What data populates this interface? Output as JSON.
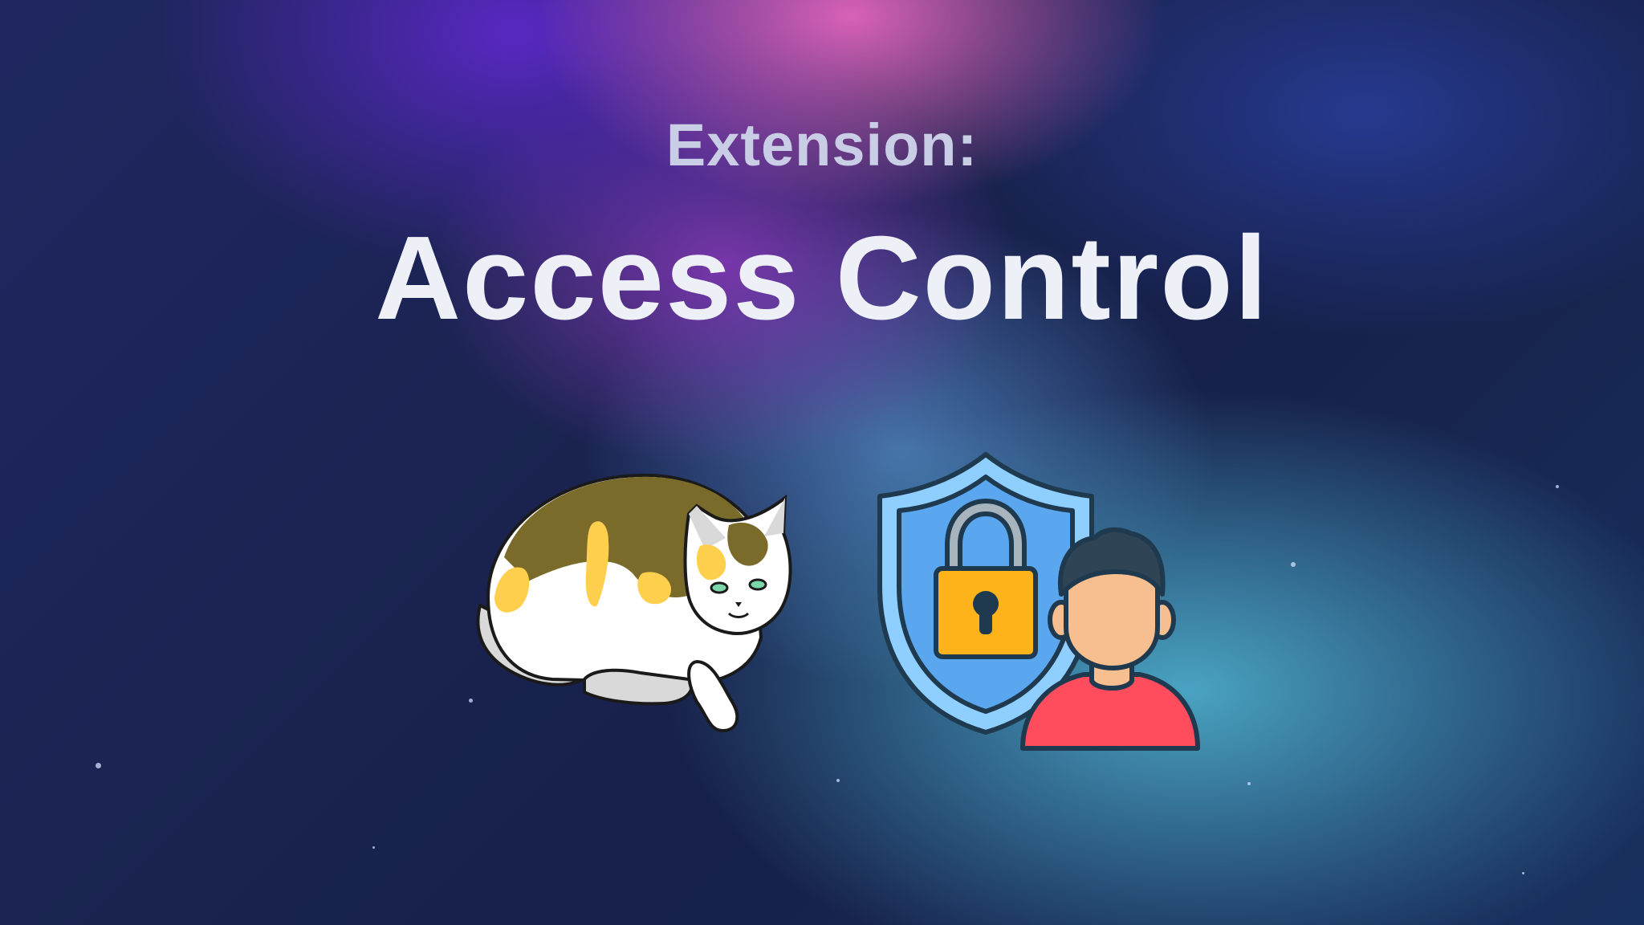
{
  "header": {
    "subtitle": "Extension:",
    "title": "Access Control"
  },
  "illustrations": {
    "left": "cat-icon",
    "right": "security-user-icon"
  },
  "colors": {
    "subtitle": "#c9cde6",
    "title": "#eef0f8",
    "shield": "#8fcfff",
    "lock": "#ffb31a",
    "shirt": "#ff4d5e",
    "skin": "#f7bf8f"
  }
}
